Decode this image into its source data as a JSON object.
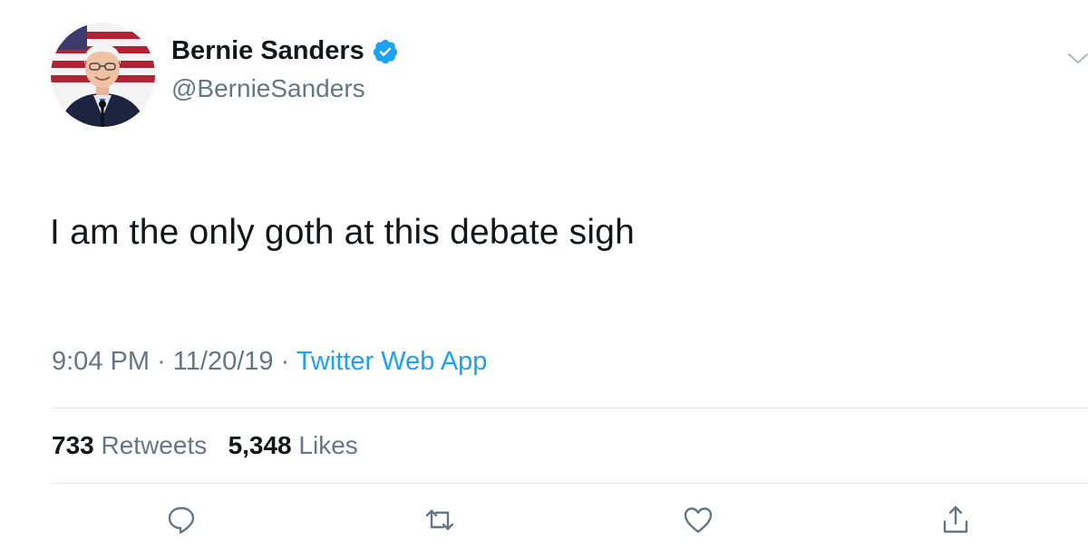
{
  "user": {
    "display_name": "Bernie Sanders",
    "handle": "@BernieSanders",
    "verified": true
  },
  "tweet": {
    "text": "I am the only goth at this debate sigh",
    "time": "9:04 PM",
    "date": "11/20/19",
    "source": "Twitter Web App",
    "separator": "·"
  },
  "stats": {
    "retweets": "733",
    "retweets_label": "Retweets",
    "likes": "5,348",
    "likes_label": "Likes"
  },
  "icons": {
    "more": "chevron-down-icon",
    "reply": "reply-icon",
    "retweet": "retweet-icon",
    "like": "heart-icon",
    "share": "share-icon",
    "verified": "verified-badge-icon"
  },
  "colors": {
    "accent": "#1da1f2",
    "secondary_text": "#657786",
    "primary_text": "#14171a",
    "divider": "#e1e8ed"
  }
}
